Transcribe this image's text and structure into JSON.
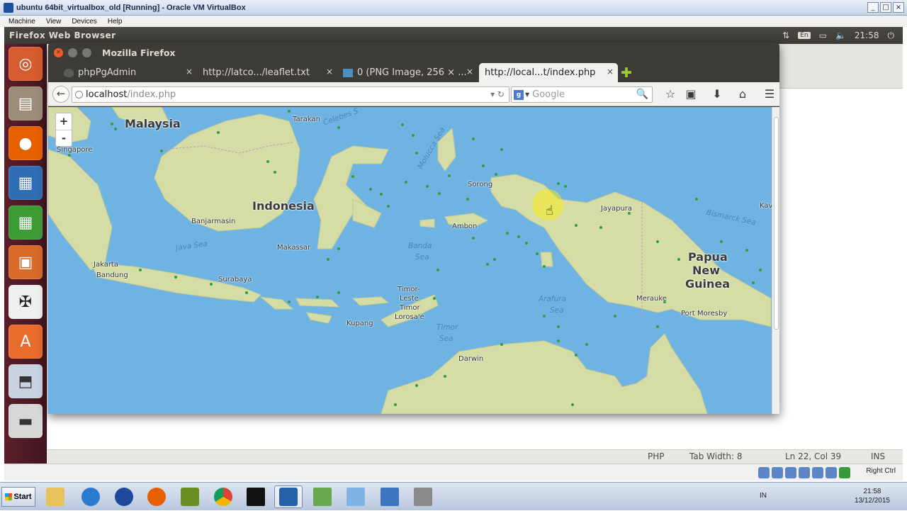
{
  "vbox": {
    "title": "ubuntu 64bit_virtualbox_old [Running] - Oracle VM VirtualBox",
    "menu": [
      "Machine",
      "View",
      "Devices",
      "Help"
    ],
    "host_key": "Right Ctrl"
  },
  "ubuntu_panel": {
    "app_name": "Firefox Web Browser",
    "keyboard": "En",
    "time": "21:58"
  },
  "firefox": {
    "window_title": "Mozilla Firefox",
    "tabs": [
      {
        "label": "phpPgAdmin"
      },
      {
        "label": "http://latco.../leaflet.txt"
      },
      {
        "label": "0 (PNG Image, 256 × ..."
      },
      {
        "label": "http://local...t/index.php"
      }
    ],
    "url_host": "localhost",
    "url_path": "/index.php",
    "search_placeholder": "Google"
  },
  "map": {
    "labels": {
      "malaysia": "Malaysia",
      "indonesia": "Indonesia",
      "papua": "Papua",
      "new": "New",
      "guinea": "Guinea",
      "singapore": "Singapore",
      "tarakan": "Tarakan",
      "banjarmasin": "Banjarmasin",
      "makassar": "Makassar",
      "jakarta": "Jakarta",
      "bandung": "Bandung",
      "surabaya": "Surabaya",
      "ambon": "Ambon",
      "sorong": "Sorong",
      "jayapura": "Jayapura",
      "merauke": "Merauke",
      "port_moresby": "Port Moresby",
      "timor_leste_1": "Timor-",
      "timor_leste_2": "Leste",
      "timor_leste_3": "Timor",
      "kupang": "Kupang",
      "lorosae": "Lorosa'e",
      "darwin": "Darwin",
      "celebes": "Celebes S",
      "molucca": "Molucca Sea",
      "java_sea": "Java Sea",
      "banda": "Banda",
      "banda2": "Sea",
      "timor_sea": "Timor",
      "timor_sea2": "Sea",
      "arafura": "Arafura",
      "arafura2": "Sea",
      "bismarck": "Bismarck Sea",
      "kav": "Kav"
    },
    "zoom_in": "+",
    "zoom_out": "-"
  },
  "gedit_status": {
    "language": "PHP",
    "tab_width": "Tab Width: 8",
    "position": "Ln 22, Col 39",
    "mode": "INS"
  },
  "taskbar": {
    "start": "Start",
    "lang": "IN",
    "time": "21:58",
    "date": "13/12/2015"
  },
  "colors": {
    "water": "#6fb3e3",
    "land": "#d6dca6",
    "marker": "#2e9e3e",
    "launcher": "#5a1e2a",
    "panel": "#3c3b37"
  }
}
